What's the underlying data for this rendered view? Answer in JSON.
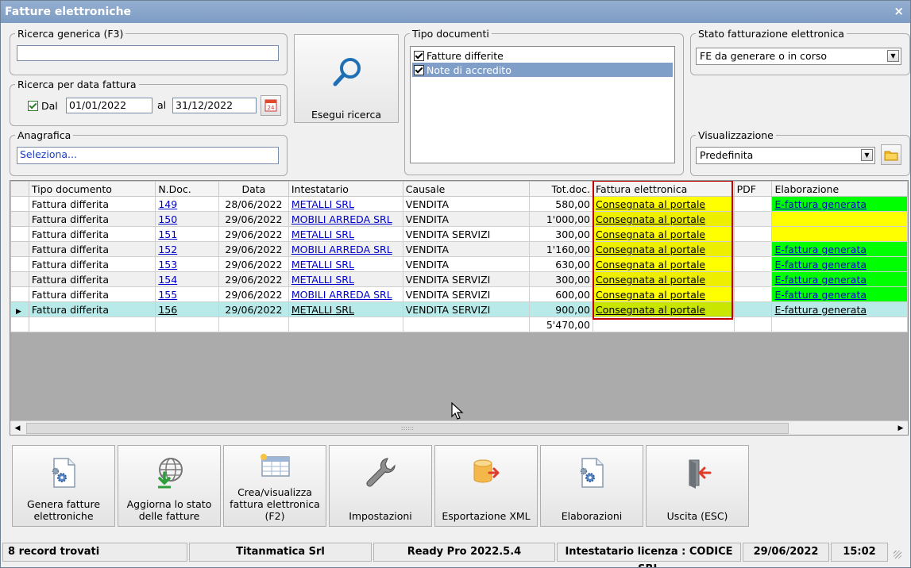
{
  "window": {
    "title": "Fatture elettroniche",
    "close": "×"
  },
  "search": {
    "generic_legend": "Ricerca generica (F3)",
    "generic_value": "",
    "date_legend": "Ricerca per data fattura",
    "dal_label": "Dal",
    "dal_checked": true,
    "date_from": "01/01/2022",
    "al_label": "al",
    "date_to": "31/12/2022",
    "calendar_day": "24",
    "anagrafica_legend": "Anagrafica",
    "anagrafica_value": "Seleziona...",
    "execute_label": "Esegui ricerca"
  },
  "doc_types": {
    "legend": "Tipo documenti",
    "items": [
      {
        "label": "Fatture differite",
        "checked": true
      },
      {
        "label": "Note di accredito",
        "checked": true
      }
    ]
  },
  "fe_state": {
    "legend": "Stato fatturazione elettronica",
    "value": "FE da generare o in corso"
  },
  "view": {
    "legend": "Visualizzazione",
    "value": "Predefinita"
  },
  "grid": {
    "columns": [
      "Tipo documento",
      "N.Doc.",
      "Data",
      "Intestatario",
      "Causale",
      "Tot.doc.",
      "Fattura elettronica",
      "PDF",
      "Elaborazione"
    ],
    "rows": [
      {
        "tipo": "Fattura differita",
        "ndoc": "149",
        "data": "28/06/2022",
        "intestatario": "METALLI SRL",
        "causale": "VENDITA",
        "tot": "580,00",
        "fe": "Consegnata al portale",
        "pdf": "",
        "elab": "E-fattura generata",
        "elab_color": "green"
      },
      {
        "tipo": "Fattura differita",
        "ndoc": "150",
        "data": "29/06/2022",
        "intestatario": "MOBILI ARREDA SRL",
        "causale": "VENDITA",
        "tot": "1'000,00",
        "fe": "Consegnata al portale",
        "pdf": "",
        "elab": "",
        "elab_color": "yellow"
      },
      {
        "tipo": "Fattura differita",
        "ndoc": "151",
        "data": "29/06/2022",
        "intestatario": "METALLI SRL",
        "causale": "VENDITA SERVIZI",
        "tot": "300,00",
        "fe": "Consegnata al portale",
        "pdf": "",
        "elab": "",
        "elab_color": "yellow"
      },
      {
        "tipo": "Fattura differita",
        "ndoc": "152",
        "data": "29/06/2022",
        "intestatario": "MOBILI ARREDA SRL",
        "causale": "VENDITA",
        "tot": "1'160,00",
        "fe": "Consegnata al portale",
        "pdf": "",
        "elab": "E-fattura generata",
        "elab_color": "green"
      },
      {
        "tipo": "Fattura differita",
        "ndoc": "153",
        "data": "29/06/2022",
        "intestatario": "METALLI SRL",
        "causale": "VENDITA",
        "tot": "630,00",
        "fe": "Consegnata al portale",
        "pdf": "",
        "elab": "E-fattura generata",
        "elab_color": "green"
      },
      {
        "tipo": "Fattura differita",
        "ndoc": "154",
        "data": "29/06/2022",
        "intestatario": "METALLI SRL",
        "causale": "VENDITA SERVIZI",
        "tot": "300,00",
        "fe": "Consegnata al portale",
        "pdf": "",
        "elab": "E-fattura generata",
        "elab_color": "green"
      },
      {
        "tipo": "Fattura differita",
        "ndoc": "155",
        "data": "29/06/2022",
        "intestatario": "MOBILI ARREDA SRL",
        "causale": "VENDITA SERVIZI",
        "tot": "600,00",
        "fe": "Consegnata al portale",
        "pdf": "",
        "elab": "E-fattura generata",
        "elab_color": "green"
      },
      {
        "tipo": "Fattura differita",
        "ndoc": "156",
        "data": "29/06/2022",
        "intestatario": "METALLI SRL",
        "causale": "VENDITA SERVIZI",
        "tot": "900,00",
        "fe": "Consegnata al portale",
        "pdf": "",
        "elab": "E-fattura generata",
        "elab_color": "selected",
        "selected": true
      }
    ],
    "total": "5'470,00",
    "scroll_grip": "::::::"
  },
  "actions": [
    {
      "label": "Genera fatture elettroniche",
      "icon": "document-gear-icon"
    },
    {
      "label": "Aggiorna lo stato delle fatture",
      "icon": "globe-download-icon"
    },
    {
      "label": "Crea/visualizza fattura elettronica (F2)",
      "icon": "table-sun-icon"
    },
    {
      "label": "Impostazioni",
      "icon": "wrench-icon"
    },
    {
      "label": "Esportazione XML",
      "icon": "database-export-icon"
    },
    {
      "label": "Elaborazioni",
      "icon": "document-gear-icon"
    },
    {
      "label": "Uscita (ESC)",
      "icon": "exit-door-icon"
    }
  ],
  "status": {
    "records": "8 record trovati",
    "company": "Titanmatica Srl",
    "version": "Ready Pro 2022.5.4",
    "license": "Intestatario licenza : CODICE SRL",
    "date": "29/06/2022",
    "time": "15:02"
  },
  "colors": {
    "titlebar": "#7e9cc4",
    "fe_cell": "#ffff00",
    "elab_green": "#00ff00",
    "selected_row": "#b8eaea",
    "highlight_border": "#c00000"
  }
}
